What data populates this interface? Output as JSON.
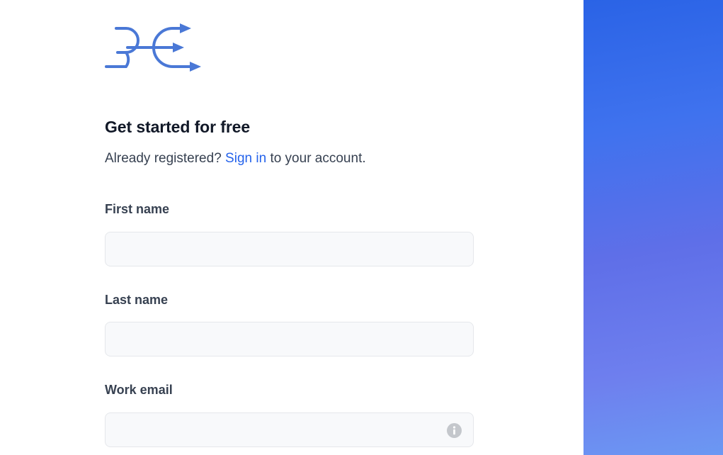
{
  "logo": {
    "icon": "split-arrows-icon",
    "color": "#4a78d6"
  },
  "signup": {
    "heading": "Get started for free",
    "subline_prefix": "Already registered?",
    "signin_link": "Sign in",
    "subline_suffix": "to your account."
  },
  "fields": {
    "first_name": {
      "label": "First name",
      "value": ""
    },
    "last_name": {
      "label": "Last name",
      "value": ""
    },
    "work_email": {
      "label": "Work email",
      "value": "",
      "icon": "info-icon"
    }
  },
  "colors": {
    "link": "#2563eb",
    "side_panel_top": "#2a63e6",
    "side_panel_bottom": "#6b98f3"
  }
}
